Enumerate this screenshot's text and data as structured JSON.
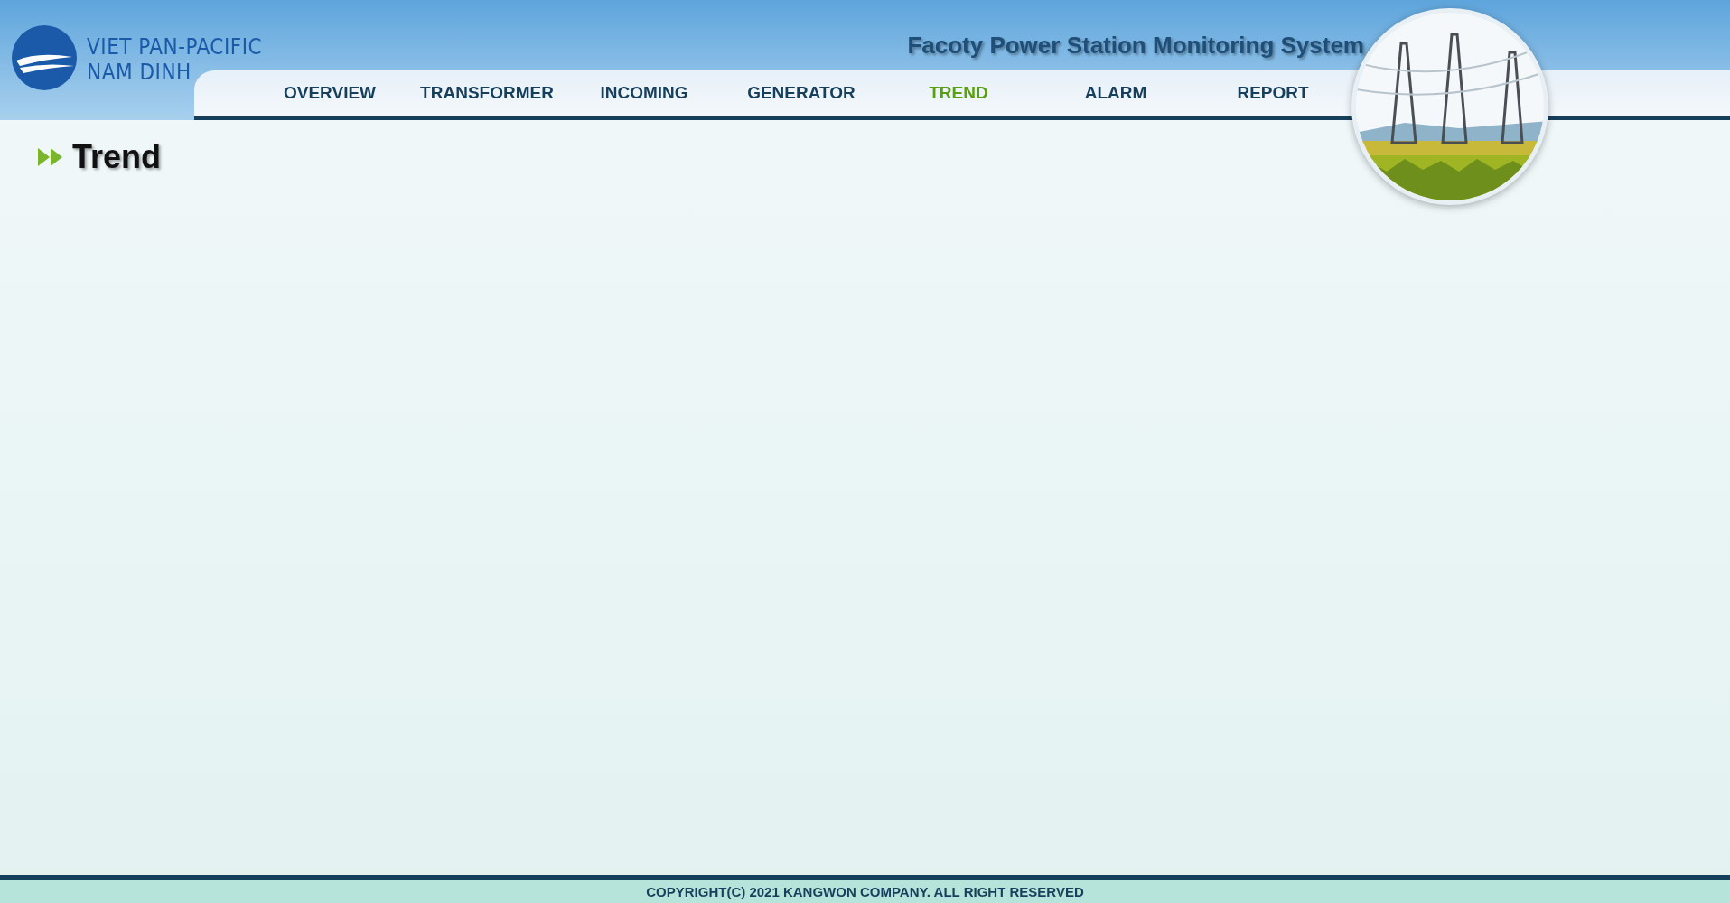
{
  "logo": {
    "lines": [
      "VIET PAN-PACIFIC",
      "NAM DINH"
    ]
  },
  "header": {
    "title": "Facoty Power Station Monitoring System"
  },
  "nav": [
    {
      "label": "OVERVIEW",
      "selected": false
    },
    {
      "label": "TRANSFORMER",
      "selected": false
    },
    {
      "label": "INCOMING",
      "selected": false
    },
    {
      "label": "GENERATOR",
      "selected": false
    },
    {
      "label": "TREND",
      "selected": true
    },
    {
      "label": "ALARM",
      "selected": false
    },
    {
      "label": "REPORT",
      "selected": false
    }
  ],
  "page": {
    "heading": "Trend"
  },
  "footer": {
    "text": "COPYRIGHT(C) 2021 KANGWON COMPANY. ALL RIGHT RESERVED"
  }
}
